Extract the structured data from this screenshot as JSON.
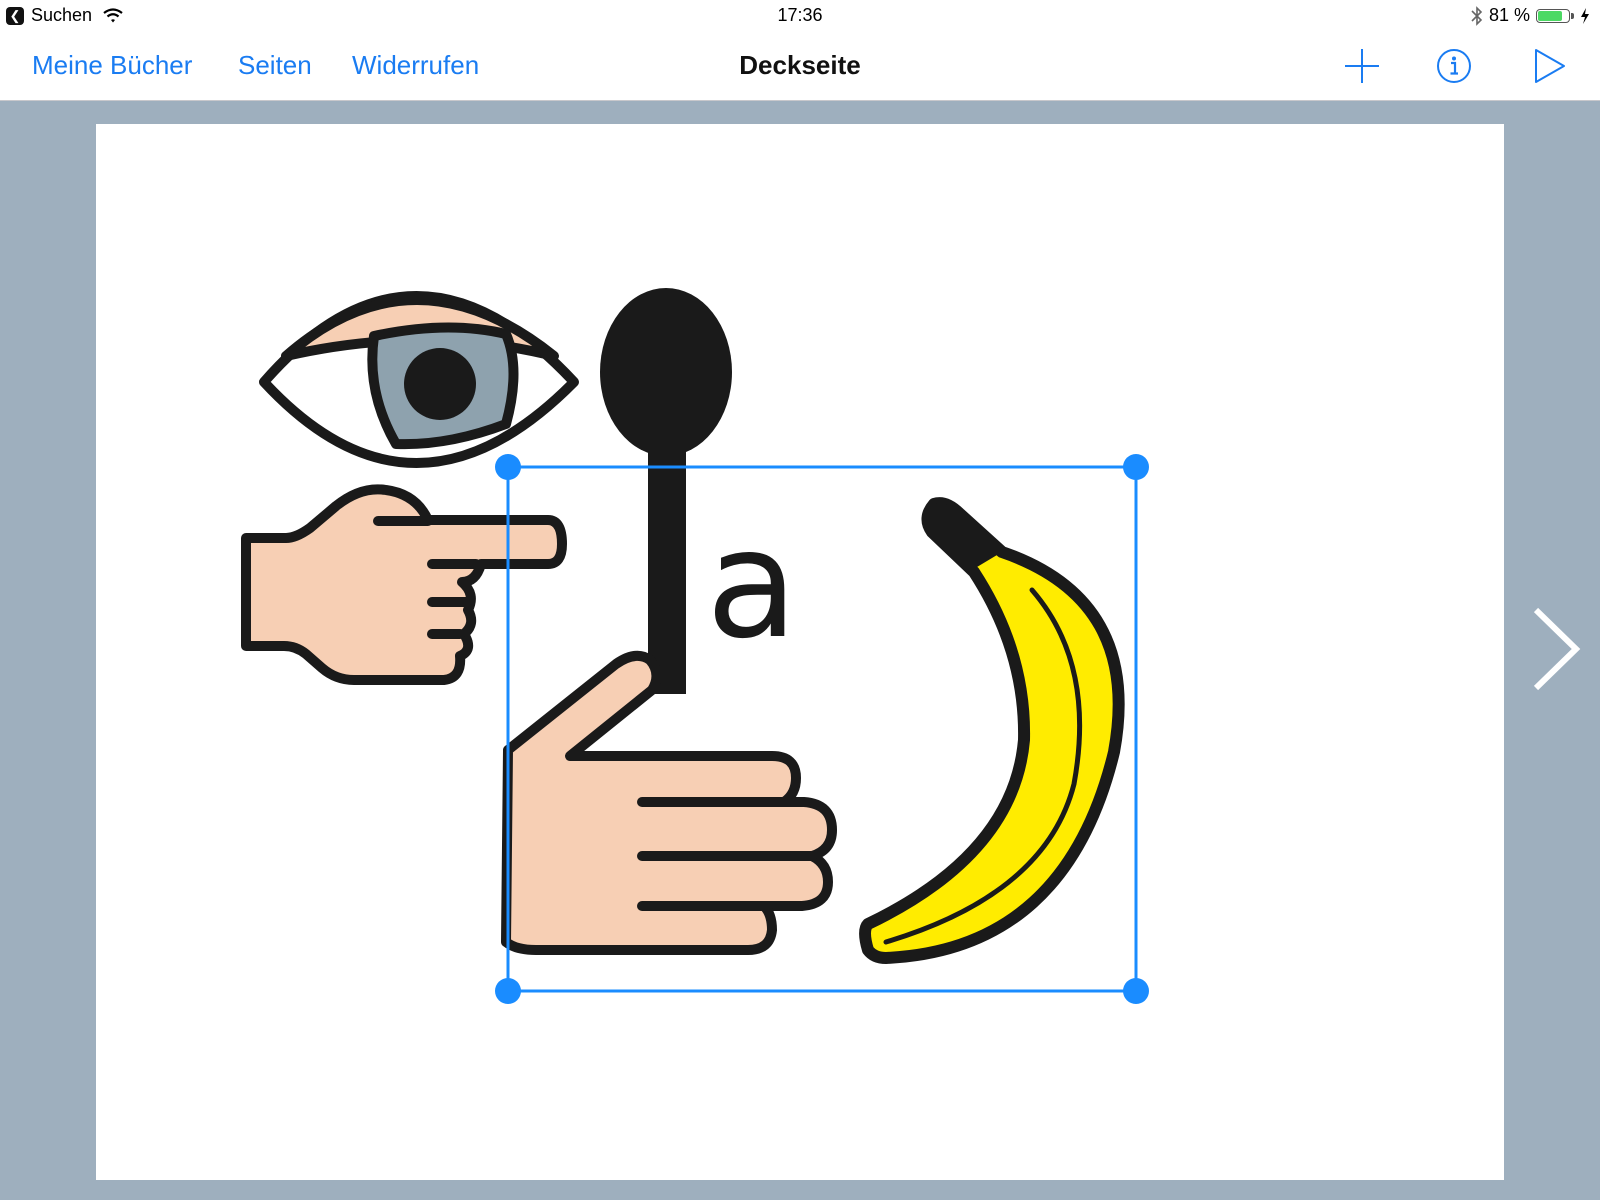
{
  "status_bar": {
    "back_app_label": "Suchen",
    "time": "17:36",
    "battery_percent_text": "81 %",
    "battery_level": 0.81,
    "icons": [
      "back-arrow-icon",
      "wifi-icon",
      "bluetooth-icon",
      "battery-icon",
      "charging-bolt-icon"
    ]
  },
  "navbar": {
    "left_buttons": [
      {
        "label": "Meine Bücher"
      },
      {
        "label": "Seiten"
      },
      {
        "label": "Widerrufen"
      }
    ],
    "title": "Deckseite",
    "right_icons": [
      "add-icon",
      "info-icon",
      "play-icon"
    ],
    "accent_color": "#1a7cf2"
  },
  "page": {
    "symbols": [
      "eye-symbol",
      "pointing-hand-symbol",
      "spoon-symbol",
      "hand-holding-symbol",
      "banana-symbol"
    ],
    "letter": "a",
    "selection": {
      "handles": 4,
      "color": "#1a8cff"
    }
  },
  "colors": {
    "background": "#9eafbe",
    "skin": "#f7cfb4",
    "iris": "#8ea2ae",
    "banana": "#ffec00",
    "outline": "#1a1a1a"
  }
}
